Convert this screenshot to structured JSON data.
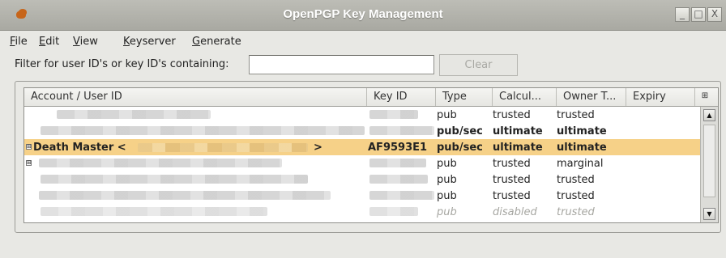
{
  "window": {
    "title": "OpenPGP Key Management",
    "controls": [
      "_",
      "□",
      "X"
    ]
  },
  "menubar": {
    "items": [
      {
        "mnemonic": "F",
        "rest": "ile"
      },
      {
        "mnemonic": "E",
        "rest": "dit"
      },
      {
        "mnemonic": "V",
        "rest": "iew"
      },
      {
        "mnemonic": "K",
        "rest": "eyserver"
      },
      {
        "mnemonic": "G",
        "rest": "enerate"
      }
    ]
  },
  "filter": {
    "label": "Filter for user ID's or key ID's containing:",
    "value": "",
    "clear_label": "Clear"
  },
  "table": {
    "columns": [
      "Account / User ID",
      "Key ID",
      "Type",
      "Calcul...",
      "Owner T...",
      "Expiry"
    ],
    "column_picker_icon": "⊞",
    "rows": [
      {
        "id_prefix": "",
        "id_suffix": "",
        "key": "",
        "type": "pub",
        "calc": "trusted",
        "owner": "trusted"
      },
      {
        "id_prefix": "",
        "id_suffix": "",
        "key": "",
        "type": "pub/sec",
        "calc": "ultimate",
        "owner": "ultimate"
      },
      {
        "id_prefix": "Death Master <",
        "id_suffix": ">",
        "key": "AF9593E1",
        "type": "pub/sec",
        "calc": "ultimate",
        "owner": "ultimate"
      },
      {
        "id_prefix": "",
        "id_suffix": "",
        "key": "",
        "type": "pub",
        "calc": "trusted",
        "owner": "marginal"
      },
      {
        "id_prefix": "",
        "id_suffix": "",
        "key": "",
        "type": "pub",
        "calc": "trusted",
        "owner": "trusted"
      },
      {
        "id_prefix": "",
        "id_suffix": "",
        "key": "",
        "type": "pub",
        "calc": "trusted",
        "owner": "trusted"
      },
      {
        "id_prefix": "",
        "id_suffix": "",
        "key": "",
        "type": "pub",
        "calc": "disabled",
        "owner": "trusted"
      }
    ]
  },
  "colors": {
    "selection": "#f6d188",
    "titlebar": "#b4b4ae",
    "app_icon": "#c7651a"
  },
  "icons": {
    "app": "openpgp-key-icon",
    "scroll_up": "▲",
    "scroll_down": "▼",
    "expander": "⊞"
  }
}
